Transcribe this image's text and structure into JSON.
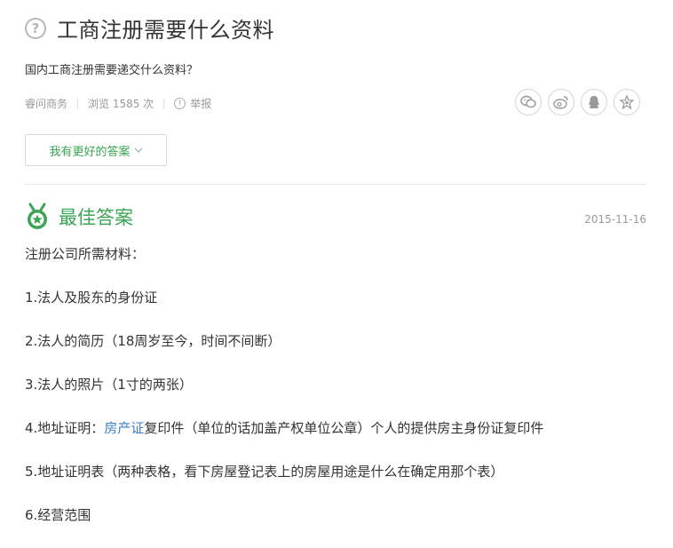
{
  "question": {
    "title": "工商注册需要什么资料",
    "description": "国内工商注册需要递交什么资料？",
    "source": "睿问商务",
    "views": "浏览 1585 次",
    "report": "举报"
  },
  "share_icons": [
    "wechat-icon",
    "weibo-icon",
    "qq-icon",
    "favorite-star-icon"
  ],
  "better_answer_button": "我有更好的答案",
  "best_answer": {
    "label": "最佳答案",
    "date": "2015-11-16",
    "lines": {
      "l0": "注册公司所需材料：",
      "l1": "1.法人及股东的身份证",
      "l2": "2.法人的简历（18周岁至今，时间不间断）",
      "l3": "3.法人的照片（1寸的两张）",
      "l4_prefix": "4.地址证明：",
      "l4_link": "房产证",
      "l4_suffix": "复印件（单位的话加盖产权单位公章）个人的提供房主身份证复印件",
      "l5": "5.地址证明表（两种表格，看下房屋登记表上的房屋用途是什么在确定用那个表）",
      "l6": "6.经营范围"
    }
  },
  "colors": {
    "accent_green": "#3aa553",
    "link_blue": "#3a7fc8",
    "muted_gray": "#999999"
  }
}
